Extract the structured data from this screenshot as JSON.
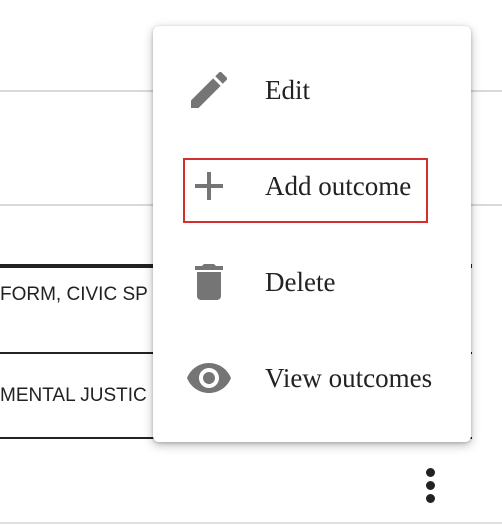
{
  "table": {
    "rows": [
      {
        "text": "FORM, CIVIC SP"
      },
      {
        "text": "MENTAL JUSTIC"
      }
    ]
  },
  "menu": {
    "items": [
      {
        "label": "Edit",
        "icon": "pencil-icon"
      },
      {
        "label": "Add outcome",
        "icon": "plus-icon"
      },
      {
        "label": "Delete",
        "icon": "trash-icon"
      },
      {
        "label": "View outcomes",
        "icon": "eye-icon"
      }
    ]
  },
  "colors": {
    "icon": "#757575",
    "text": "#222222",
    "focus": "#d32f2f"
  }
}
